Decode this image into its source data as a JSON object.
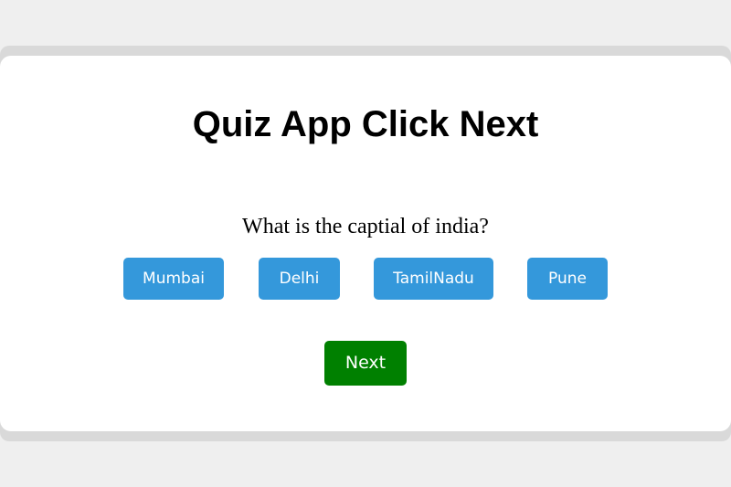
{
  "quiz": {
    "title": "Quiz App Click Next",
    "question": "What is the captial of india?",
    "options": [
      "Mumbai",
      "Delhi",
      "TamilNadu",
      "Pune"
    ],
    "next_label": "Next"
  },
  "colors": {
    "page_background": "#efefef",
    "frame": "#d9d9d9",
    "card": "#ffffff",
    "option_button": "#3498db",
    "next_button": "#008000",
    "button_text": "#ffffff"
  }
}
